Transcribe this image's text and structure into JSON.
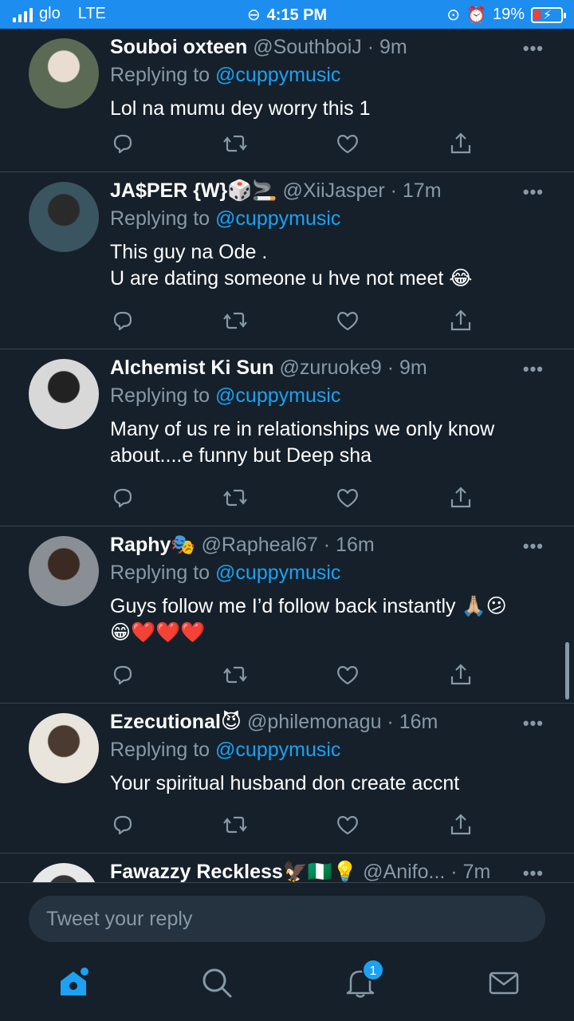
{
  "status_bar": {
    "carrier": "glo",
    "network": "LTE",
    "time": "4:15 PM",
    "battery": "19%"
  },
  "tweets": [
    {
      "name": "Souboi oxteen",
      "name_emoji": "",
      "handle": "@SouthboiJ",
      "time": "9m",
      "replying_label": "Replying to",
      "replying_to": "@cuppymusic",
      "lines": [
        "Lol na mumu dey worry this 1"
      ],
      "avatar_colors": [
        "#5a6a55",
        "#e8ddd0"
      ]
    },
    {
      "name": "JA$PER {W}",
      "name_emoji": "🎲🚬",
      "handle": "@XiiJasper",
      "time": "17m",
      "replying_label": "Replying to",
      "replying_to": "@cuppymusic",
      "lines": [
        "This guy na Ode .",
        "U are dating someone u hve not meet 😂"
      ],
      "avatar_colors": [
        "#3a5560",
        "#2a2a2a"
      ]
    },
    {
      "name": "Alchemist Ki Sun",
      "name_emoji": "",
      "handle": "@zuruoke9",
      "time": "9m",
      "replying_label": "Replying to",
      "replying_to": "@cuppymusic",
      "lines": [
        "Many of us re in relationships we only know",
        "about....e funny but Deep sha"
      ],
      "avatar_colors": [
        "#d8d8d8",
        "#222222"
      ]
    },
    {
      "name": "Raphy",
      "name_emoji": "🎭",
      "handle": "@Rapheal67",
      "time": "16m",
      "replying_label": "Replying to",
      "replying_to": "@cuppymusic",
      "lines": [
        "Guys follow me I’d follow back instantly 🙏🏼😕",
        "😁❤️❤️❤️"
      ],
      "avatar_colors": [
        "#8a8f95",
        "#3b2a22"
      ]
    },
    {
      "name": "Ezecutional",
      "name_emoji": "😈",
      "handle": "@philemonagu",
      "time": "16m",
      "replying_label": "Replying to",
      "replying_to": "@cuppymusic",
      "lines": [
        "Your spiritual husband don create accnt"
      ],
      "avatar_colors": [
        "#e9e4dc",
        "#4b3a30"
      ]
    },
    {
      "name": "Fawazzy Reckless",
      "name_emoji": "🦅🇳🇬💡",
      "handle": "@Anifo...",
      "time": "7m",
      "replying_label": "",
      "replying_to": "",
      "lines": [],
      "avatar_colors": [
        "#e8e8e8",
        "#333333"
      ]
    }
  ],
  "icons": {
    "reply": "reply-icon",
    "retweet": "retweet-icon",
    "like": "heart-icon",
    "share": "share-icon",
    "more": "more-icon"
  },
  "reply_box": {
    "placeholder": "Tweet your reply"
  },
  "tabbar": {
    "notifications_badge": "1"
  },
  "colors": {
    "background": "#15202b",
    "accent": "#1da1f2",
    "muted": "#8899a6",
    "status_bar": "#1d8df0"
  }
}
